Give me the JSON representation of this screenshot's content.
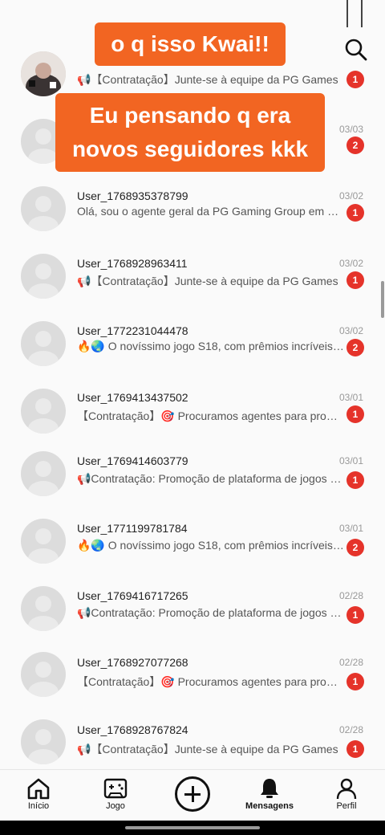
{
  "rows": [
    {
      "user": "",
      "date": "",
      "msg": "📢【Contratação】Junte-se à equipe da PG Games",
      "count": "1"
    },
    {
      "user": "",
      "date": "03/03",
      "msg": "",
      "count": "2"
    },
    {
      "user": "User_1768935378799",
      "date": "03/02",
      "msg": "Olá, sou o agente geral da PG Gaming Group em São...",
      "count": "1"
    },
    {
      "user": "User_1768928963411",
      "date": "03/02",
      "msg": "📢【Contratação】Junte-se à equipe da PG Games",
      "count": "1"
    },
    {
      "user": "User_1772231044478",
      "date": "03/02",
      "msg": "🔥🌏 O novíssimo jogo S18, com prêmios incríveis e...",
      "count": "2"
    },
    {
      "user": "User_1769413437502",
      "date": "03/01",
      "msg": "【Contratação】🎯 Procuramos agentes para prom...",
      "count": "1"
    },
    {
      "user": "User_1769414603779",
      "date": "03/01",
      "msg": "📢Contratação: Promoção de plataforma de jogos P...",
      "count": "1"
    },
    {
      "user": "User_1771199781784",
      "date": "03/01",
      "msg": "🔥🌏 O novíssimo jogo S18, com prêmios incríveis e...",
      "count": "2"
    },
    {
      "user": "User_1769416717265",
      "date": "02/28",
      "msg": "📢Contratação: Promoção de plataforma de jogos P...",
      "count": "1"
    },
    {
      "user": "User_1768927077268",
      "date": "02/28",
      "msg": "【Contratação】🎯 Procuramos agentes para prom...",
      "count": "1"
    },
    {
      "user": "User_1768928767824",
      "date": "02/28",
      "msg": "📢【Contratação】Junte-se à equipe da PG Games",
      "count": "1"
    }
  ],
  "captions": {
    "top": "o q isso Kwai!!",
    "middle_line1": "Eu pensando q era",
    "middle_line2": "novos seguidores kkk"
  },
  "nav": {
    "home": "Início",
    "game": "Jogo",
    "messages": "Mensagens",
    "profile": "Perfil"
  },
  "colors": {
    "badge": "#e5332a",
    "caption_bg": "#f26522"
  },
  "icons": [
    "search-icon",
    "home-icon",
    "gamepad-icon",
    "plus-icon",
    "bell-icon",
    "person-icon"
  ]
}
